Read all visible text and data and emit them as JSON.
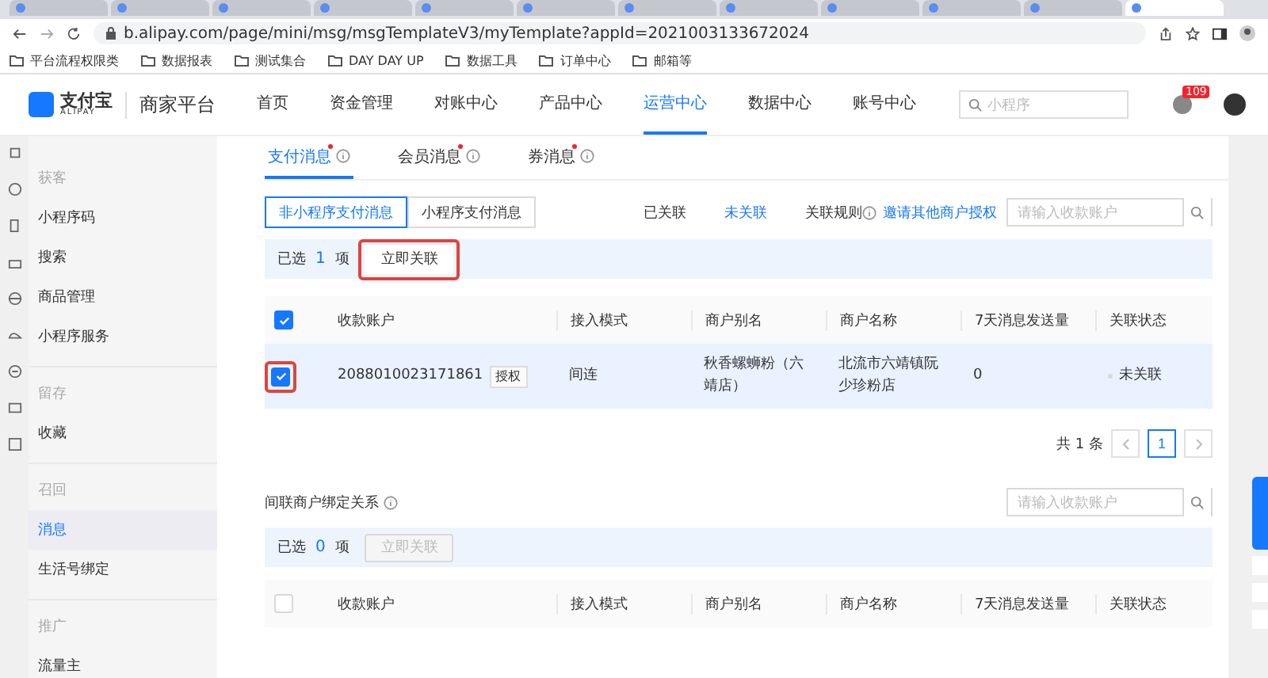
{
  "browser": {
    "tabs": [
      {
        "selected": false
      },
      {
        "selected": false
      },
      {
        "selected": false
      },
      {
        "selected": false
      },
      {
        "selected": false
      },
      {
        "selected": false
      },
      {
        "selected": false
      },
      {
        "selected": false
      },
      {
        "selected": false
      },
      {
        "selected": false
      },
      {
        "selected": false
      },
      {
        "selected": true
      }
    ],
    "url": "b.alipay.com/page/mini/msg/msgTemplateV3/myTemplate?appId=2021003133672024",
    "bookmarks": [
      "平台流程权限类",
      "数据报表",
      "测试集合",
      "DAY DAY UP",
      "数据工具",
      "订单中心",
      "邮箱等"
    ]
  },
  "header": {
    "logo_main": "支付宝",
    "logo_sub": "ALIPAY",
    "platform": "商家平台",
    "nav": [
      {
        "label": "首页",
        "selected": false
      },
      {
        "label": "资金管理",
        "selected": false
      },
      {
        "label": "对账中心",
        "selected": false
      },
      {
        "label": "产品中心",
        "selected": false
      },
      {
        "label": "运营中心",
        "selected": true
      },
      {
        "label": "数据中心",
        "selected": false
      },
      {
        "label": "账号中心",
        "selected": false
      }
    ],
    "search_placeholder": "小程序",
    "notification_count": "109"
  },
  "sidebar": {
    "groups": [
      {
        "title": "获客",
        "items": [
          {
            "label": "小程序码",
            "selected": false
          },
          {
            "label": "搜索",
            "selected": false
          },
          {
            "label": "商品管理",
            "selected": false
          },
          {
            "label": "小程序服务",
            "selected": false
          }
        ]
      },
      {
        "title": "留存",
        "items": [
          {
            "label": "收藏",
            "selected": false
          }
        ]
      },
      {
        "title": "召回",
        "items": [
          {
            "label": "消息",
            "selected": true
          },
          {
            "label": "生活号绑定",
            "selected": false
          }
        ]
      },
      {
        "title": "推广",
        "items": [
          {
            "label": "流量主",
            "selected": false
          }
        ]
      }
    ]
  },
  "tabs": [
    {
      "label": "支付消息",
      "selected": true,
      "dot": true
    },
    {
      "label": "会员消息",
      "selected": false,
      "dot": true
    },
    {
      "label": "券消息",
      "selected": false,
      "dot": true
    }
  ],
  "segments": [
    {
      "label": "非小程序支付消息",
      "selected": true
    },
    {
      "label": "小程序支付消息",
      "selected": false
    }
  ],
  "filters": [
    {
      "label": "已关联",
      "selected": false
    },
    {
      "label": "未关联",
      "selected": true
    }
  ],
  "rule_label": "关联规则",
  "invite_link": "邀请其他商户授权",
  "sections": [
    {
      "search_placeholder": "请输入收款账户",
      "selected_prefix": "已选",
      "selected_count": "1",
      "selected_suffix": "项",
      "action": {
        "label": "立即关联",
        "disabled": false,
        "highlighted": true
      },
      "columns": [
        "收款账户",
        "接入模式",
        "商户别名",
        "商户名称",
        "7天消息发送量",
        "关联状态"
      ],
      "header_checked": true,
      "rows": [
        {
          "checked": true,
          "highlighted": true,
          "account": "2088010023171861",
          "tag": "授权",
          "mode": "间连",
          "alias": "秋香螺蛳粉（六靖店）",
          "name": "北流市六靖镇阮少珍粉店",
          "count": "0",
          "status": "未关联",
          "color": "#d9d9d9"
        }
      ],
      "pagination": {
        "total": "共 1 条",
        "pages": [
          {
            "label": "1",
            "selected": true
          }
        ]
      }
    },
    {
      "title": "间联商户绑定关系",
      "search_placeholder": "请输入收款账户",
      "selected_prefix": "已选",
      "selected_count": "0",
      "selected_suffix": "项",
      "action": {
        "label": "立即关联",
        "disabled": true,
        "highlighted": false
      },
      "columns": [
        "收款账户",
        "接入模式",
        "商户别名",
        "商户名称",
        "7天消息发送量",
        "关联状态"
      ],
      "header_checked": false
    }
  ]
}
